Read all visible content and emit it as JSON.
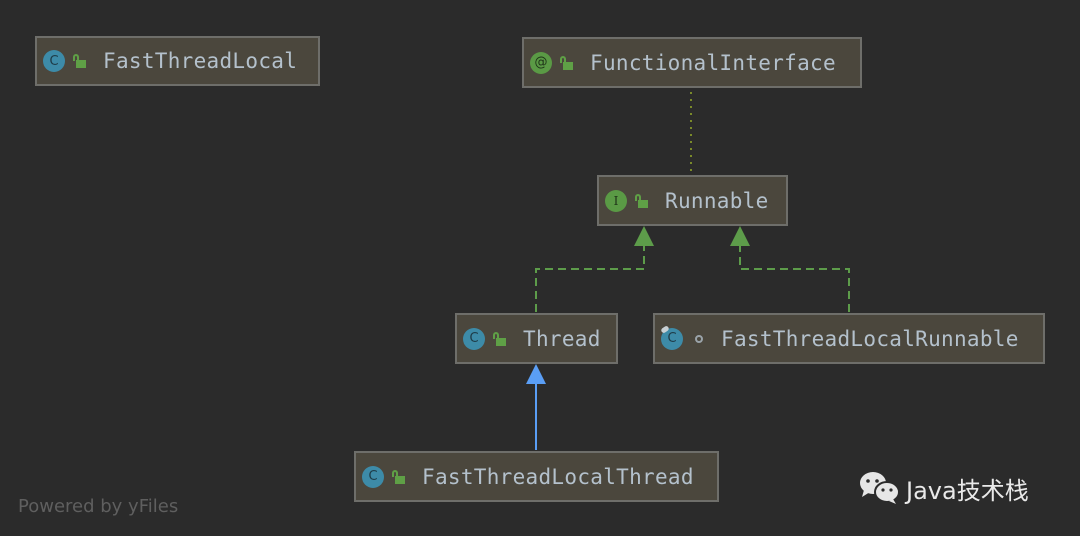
{
  "diagram": {
    "type": "uml-class-hierarchy",
    "nodes": [
      {
        "id": "fast-thread-local",
        "name": "FastThreadLocal",
        "kind": "class",
        "badge": "C",
        "visibility": "public"
      },
      {
        "id": "functional-interface",
        "name": "FunctionalInterface",
        "kind": "annotation",
        "badge": "@",
        "visibility": "public"
      },
      {
        "id": "runnable",
        "name": "Runnable",
        "kind": "interface",
        "badge": "I",
        "visibility": "public"
      },
      {
        "id": "thread",
        "name": "Thread",
        "kind": "class",
        "badge": "C",
        "visibility": "public"
      },
      {
        "id": "fast-thread-local-runnable",
        "name": "FastThreadLocalRunnable",
        "kind": "final-class",
        "badge": "C",
        "visibility": "package-private"
      },
      {
        "id": "fast-thread-local-thread",
        "name": "FastThreadLocalThread",
        "kind": "class",
        "badge": "C",
        "visibility": "public"
      }
    ],
    "edges": [
      {
        "from": "runnable",
        "to": "functional-interface",
        "relation": "annotated-by",
        "style": "dotted",
        "color": "#7a8a2a"
      },
      {
        "from": "thread",
        "to": "runnable",
        "relation": "implements",
        "style": "dashed",
        "color": "#5d9c4a"
      },
      {
        "from": "fast-thread-local-runnable",
        "to": "runnable",
        "relation": "implements",
        "style": "dashed",
        "color": "#5d9c4a"
      },
      {
        "from": "fast-thread-local-thread",
        "to": "thread",
        "relation": "extends",
        "style": "solid",
        "color": "#5a9ef5"
      }
    ]
  },
  "colors": {
    "background": "#2b2b2b",
    "node_fill": "#4b473d",
    "node_border": "#6e6e6a",
    "label_text": "#b4c1cc",
    "class_badge": "#3d8ba8",
    "interface_badge": "#5a9a45",
    "lock": "#5fa046"
  },
  "watermarks": {
    "powered_by": "Powered by yFiles",
    "brand": "Java技术栈"
  }
}
